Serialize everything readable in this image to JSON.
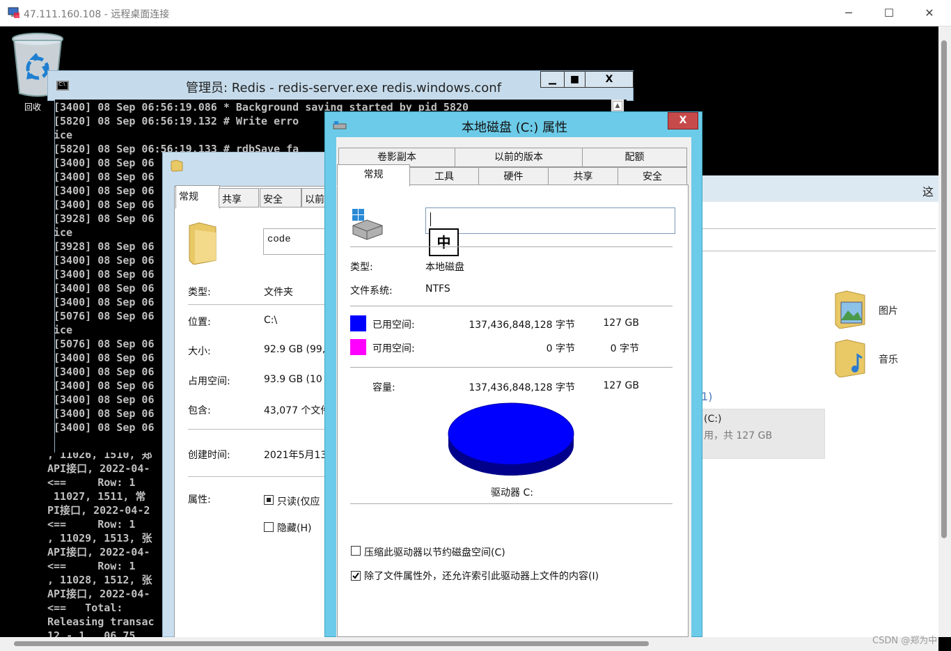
{
  "rdp": {
    "title": "47.111.160.108 - 远程桌面连接",
    "minimize": "─",
    "maximize": "☐",
    "close": "✕"
  },
  "desktop": {
    "recycle_label": "回收"
  },
  "watermark": "CSDN @郑为中",
  "explorer": {
    "toolbar_text": "这",
    "items": [
      {
        "label": "图片"
      },
      {
        "label": "音乐"
      }
    ],
    "drives_paren": "1)",
    "drive_tile": {
      "name": "(C:)",
      "info": "用，共 127 GB"
    }
  },
  "console": {
    "title": "管理员:  Redis - redis-server.exe  redis.windows.conf",
    "icon_text": "C:\\",
    "btn_min": "▁",
    "btn_max": "■",
    "btn_close": "X",
    "lines": [
      "[3400] 08 Sep 06:56:19.086 * Background saving started by pid 5820",
      "[5820] 08 Sep 06:56:19.132 # Write erro",
      "ice",
      "[5820] 08 Sep 06:56:19.133 # rdbSave fa",
      "[3400] 08 Sep 06",
      "[3400] 08 Sep 06",
      "[3400] 08 Sep 06",
      "[3400] 08 Sep 06",
      "[3928] 08 Sep 06",
      "ice",
      "[3928] 08 Sep 06",
      "[3400] 08 Sep 06",
      "[3400] 08 Sep 06",
      "[3400] 08 Sep 06",
      "[3400] 08 Sep 06",
      "[5076] 08 Sep 06",
      "ice",
      "[5076] 08 Sep 06",
      "[3400] 08 Sep 06",
      "[3400] 08 Sep 06",
      "[3400] 08 Sep 06",
      "[3400] 08 Sep 06",
      "[3400] 08 Sep 06",
      "[3400] 08 Sep 06"
    ],
    "lower_lines": [
      ", 11026, 1510, 郑",
      "API接口, 2022-04-",
      "<==     Row: 1",
      " 11027, 1511, 常",
      "PI接口, 2022-04-2",
      "<==     Row: 1",
      ", 11029, 1513, 张",
      "API接口, 2022-04-",
      "<==     Row: 1",
      ", 11028, 1512, 张",
      "API接口, 2022-04-",
      "<==   Total: ",
      "Releasing transac",
      "12 - 1   06 75"
    ]
  },
  "folder_props": {
    "tabs": [
      "常规",
      "共享",
      "安全",
      "以前"
    ],
    "name_value": "code",
    "fields": [
      {
        "label": "类型:",
        "value": "文件夹"
      },
      {
        "label": "位置:",
        "value": "C:\\"
      },
      {
        "label": "大小:",
        "value": "92.9 GB (99,"
      },
      {
        "label": "占用空间:",
        "value": "93.9 GB (10"
      },
      {
        "label": "包含:",
        "value": "43,077 个文件"
      },
      {
        "label": "创建时间:",
        "value": "2021年5月13"
      },
      {
        "label": "属性:",
        "value": ""
      }
    ],
    "readonly_label": "只读(仅应",
    "hidden_label": "隐藏(H)"
  },
  "drive_props": {
    "title": "本地磁盘 (C:) 属性",
    "close": "X",
    "tabs_top": [
      "卷影副本",
      "以前的版本",
      "配额"
    ],
    "tabs_bottom": [
      "常规",
      "工具",
      "硬件",
      "共享",
      "安全"
    ],
    "ime": "中",
    "type_label": "类型:",
    "type_value": "本地磁盘",
    "fs_label": "文件系统:",
    "fs_value": "NTFS",
    "used_label": "已用空间:",
    "used_bytes": "137,436,848,128 字节",
    "used_gb": "127 GB",
    "free_label": "可用空间:",
    "free_bytes": "0 字节",
    "free_gb": "0 字节",
    "cap_label": "容量:",
    "cap_bytes": "137,436,848,128 字节",
    "cap_gb": "127 GB",
    "drive_label": "驱动器 C:",
    "compress_label": "压缩此驱动器以节约磁盘空间(C)",
    "index_label": "除了文件属性外，还允许索引此驱动器上文件的内容(I)",
    "colors": {
      "used": "#0000ff",
      "free": "#ff00ff"
    }
  }
}
